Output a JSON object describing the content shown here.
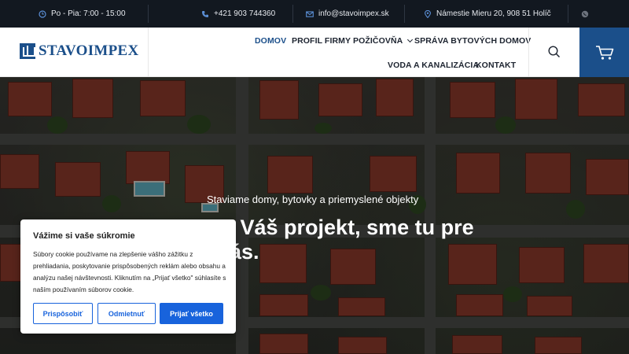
{
  "topbar": {
    "hours": "Po - Pia: 7:00 - 15:00",
    "phone": "+421 903 744360",
    "email": "info@stavoimpex.sk",
    "address": "Námestie Mieru 20, 908 51 Holíč",
    "icons": [
      "clock-icon",
      "phone-icon",
      "email-icon",
      "location-icon",
      "whatsapp-icon"
    ]
  },
  "header": {
    "logo_text": "STAVOIMPEX",
    "nav": {
      "home": "DOMOV",
      "profile": "PROFIL FIRMY",
      "rental": "POŽIČOVŇA",
      "management": "SPRÁVA BYTOVÝCH DOMOV",
      "water": "VODA A KANALIZÁCIA",
      "contact": "KONTAKT"
    },
    "brand_color": "#1b4f8a"
  },
  "hero": {
    "subtitle": "Staviame domy, bytovky a priemyslené objekty",
    "title": "m Váš projekt, sme tu pre Vás."
  },
  "cookie": {
    "title": "Vážime si vaše súkromie",
    "text": "Súbory cookie používame na zlepšenie vášho zážitku z prehliadania, poskytovanie prispôsobených reklám alebo obsahu a analýzu našej návštevnosti. Kliknutím na „Prijať všetko\" súhlasíte s naším používaním súborov cookie.",
    "customize": "Prispôsobiť",
    "reject": "Odmietnuť",
    "accept": "Prijať všetko",
    "accent_color": "#1863dc"
  }
}
